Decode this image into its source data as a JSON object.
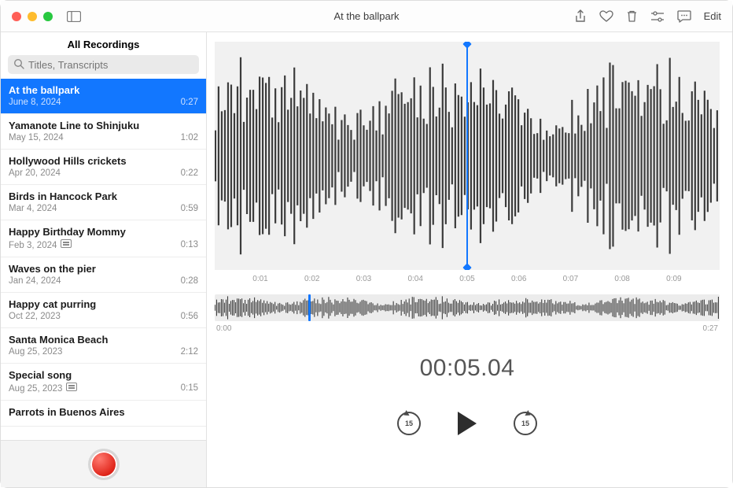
{
  "window": {
    "title": "At the ballpark"
  },
  "toolbar": {
    "edit_label": "Edit",
    "icons": {
      "share": "share-icon",
      "favorite": "heart-icon",
      "delete": "trash-icon",
      "settings": "sliders-icon",
      "transcript": "transcript-icon"
    }
  },
  "sidebar": {
    "header": "All Recordings",
    "search_placeholder": "Titles, Transcripts",
    "items": [
      {
        "title": "At the ballpark",
        "date": "June 8, 2024",
        "duration": "0:27",
        "selected": true,
        "transcript": false
      },
      {
        "title": "Yamanote Line to Shinjuku",
        "date": "May 15, 2024",
        "duration": "1:02",
        "selected": false,
        "transcript": false
      },
      {
        "title": "Hollywood Hills crickets",
        "date": "Apr 20, 2024",
        "duration": "0:22",
        "selected": false,
        "transcript": false
      },
      {
        "title": "Birds in Hancock Park",
        "date": "Mar 4, 2024",
        "duration": "0:59",
        "selected": false,
        "transcript": false
      },
      {
        "title": "Happy Birthday Mommy",
        "date": "Feb 3, 2024",
        "duration": "0:13",
        "selected": false,
        "transcript": true
      },
      {
        "title": "Waves on the pier",
        "date": "Jan 24, 2024",
        "duration": "0:28",
        "selected": false,
        "transcript": false
      },
      {
        "title": "Happy cat purring",
        "date": "Oct 22, 2023",
        "duration": "0:56",
        "selected": false,
        "transcript": false
      },
      {
        "title": "Santa Monica Beach",
        "date": "Aug 25, 2023",
        "duration": "2:12",
        "selected": false,
        "transcript": false
      },
      {
        "title": "Special song",
        "date": "Aug 25, 2023",
        "duration": "0:15",
        "selected": false,
        "transcript": true
      },
      {
        "title": "Parrots in Buenos Aires",
        "date": "",
        "duration": "",
        "selected": false,
        "transcript": false
      }
    ]
  },
  "playback": {
    "current_time_display": "00:05.04",
    "skip_seconds": "15",
    "timeline_ticks": [
      "",
      "0:01",
      "0:02",
      "0:03",
      "0:04",
      "0:05",
      "0:06",
      "0:07",
      "0:08",
      "0:09",
      ""
    ],
    "overview_start": "0:00",
    "overview_end": "0:27",
    "playhead_fraction": 0.5,
    "overview_playhead_fraction": 0.186
  },
  "colors": {
    "accent": "#1277ff"
  }
}
